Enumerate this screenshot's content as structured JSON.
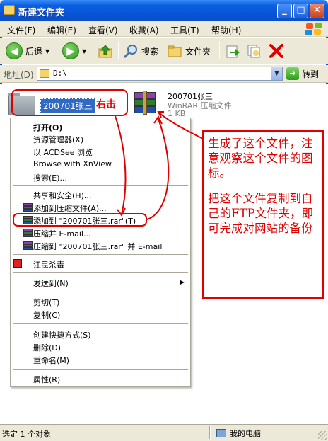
{
  "window": {
    "title": "新建文件夹"
  },
  "controls": {
    "minimize": "_",
    "maximize": "□",
    "close": "✕"
  },
  "menu": [
    {
      "label": "文件(F)"
    },
    {
      "label": "编辑(E)"
    },
    {
      "label": "查看(V)"
    },
    {
      "label": "收藏(A)"
    },
    {
      "label": "工具(T)"
    },
    {
      "label": "帮助(H)"
    }
  ],
  "toolbar": {
    "back": "后退",
    "forward_icon": "forward-arrow-icon",
    "search": "搜索",
    "folders": "文件夹"
  },
  "address": {
    "label": "地址(D)",
    "path": "D:\\",
    "go": "转到"
  },
  "content": {
    "folder_name": "200701张三",
    "right_click_label": "右击",
    "archive": {
      "name": "200701张三",
      "type": "WinRAR 压缩文件",
      "size": "1 KB"
    }
  },
  "context_menu": {
    "items": [
      {
        "label": "打开(O)",
        "bold": true
      },
      {
        "label": "资源管理器(X)"
      },
      {
        "label": "以 ACDSee 浏览"
      },
      {
        "label": "Browse with XnView"
      },
      {
        "label": "搜索(E)..."
      },
      {
        "label": "共享和安全(H)..."
      },
      {
        "label": "添加到压缩文件(A)..."
      },
      {
        "label": "添加到 \"200701张三.rar\"(T)"
      },
      {
        "label": "压缩并 E-mail..."
      },
      {
        "label": "压缩到 \"200701张三.rar\" 并 E-mail"
      },
      {
        "label": "江民杀毒"
      },
      {
        "label": "发送到(N)"
      },
      {
        "label": "剪切(T)"
      },
      {
        "label": "复制(C)"
      },
      {
        "label": "创建快捷方式(S)"
      },
      {
        "label": "删除(D)"
      },
      {
        "label": "重命名(M)"
      },
      {
        "label": "属性(R)"
      }
    ]
  },
  "annotation": {
    "line1": "生成了这个文件，注意观察这个文件的图标。",
    "line2": "把这个文件复制到自己的FTP文件夹，即可完成对网站的备份"
  },
  "status": {
    "left": "选定 1 个对象",
    "right": "我的电脑"
  },
  "colors": {
    "accent": "#0a5fe0",
    "annotation": "#e00000",
    "selection": "#316ac5"
  }
}
